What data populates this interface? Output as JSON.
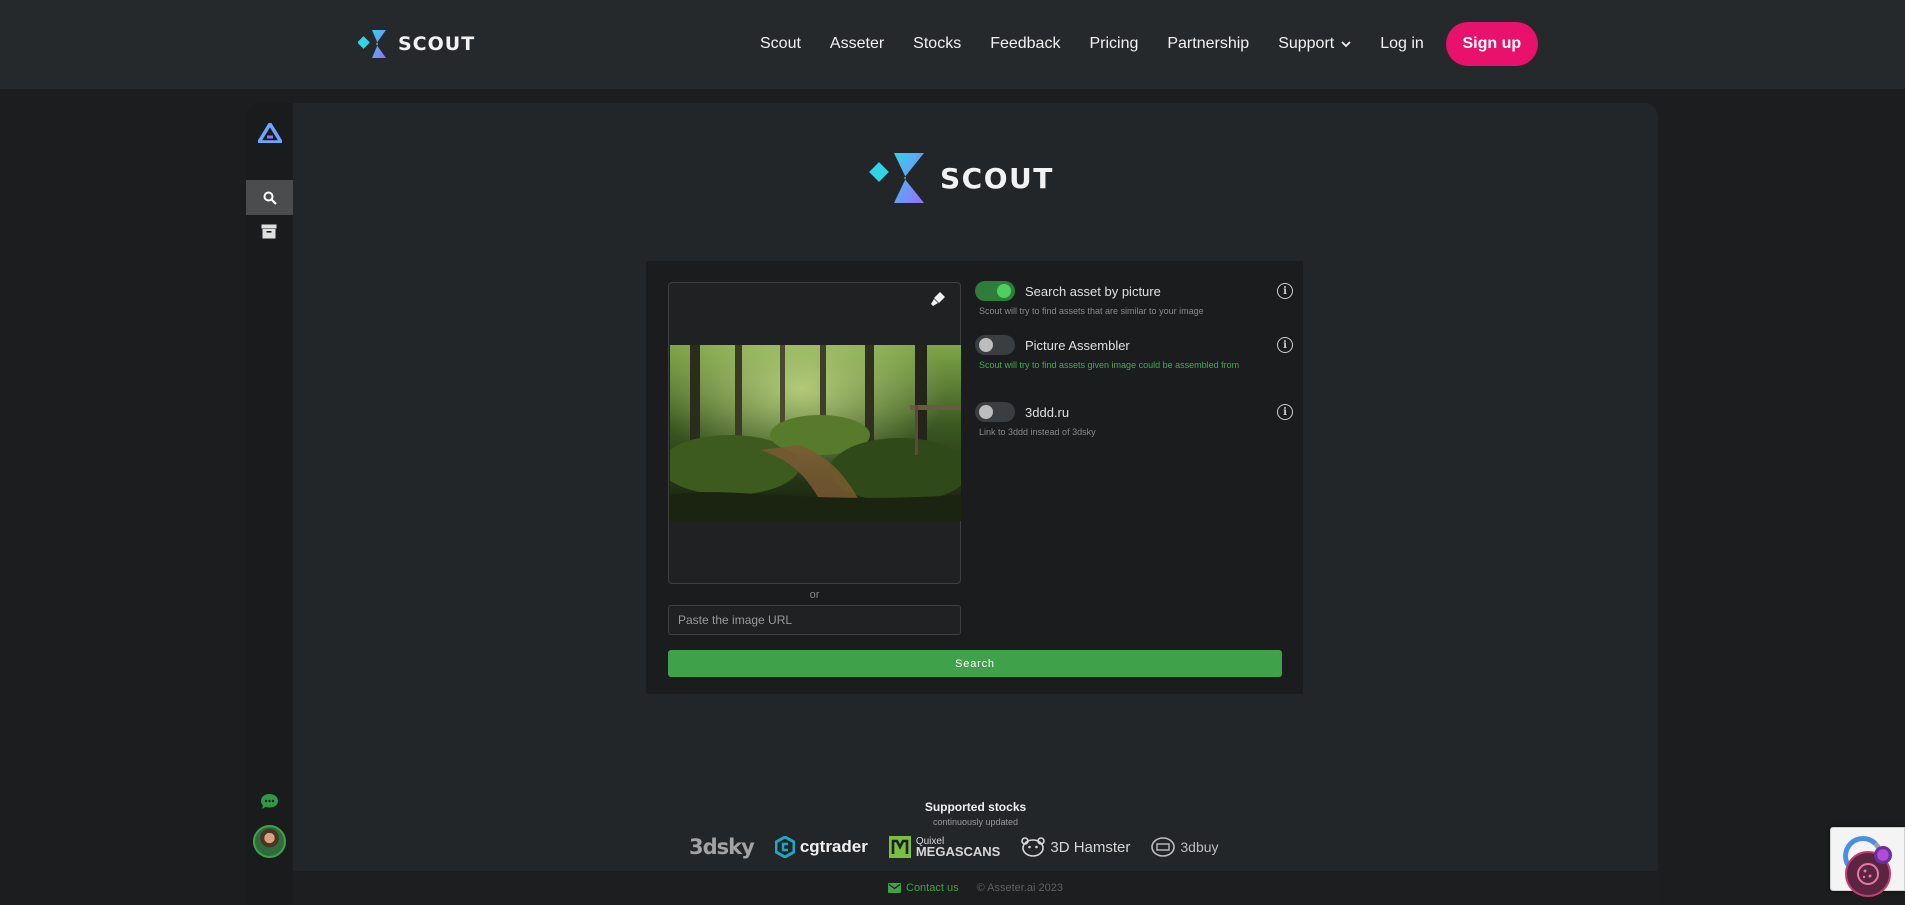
{
  "topnav": {
    "brand": "SCOUT",
    "links": [
      "Scout",
      "Asseter",
      "Stocks",
      "Feedback",
      "Pricing",
      "Partnership",
      "Support",
      "Log in"
    ],
    "signup": "Sign up"
  },
  "sidebar": {
    "items": [
      {
        "icon": "asseter-logo-icon"
      },
      {
        "icon": "search-icon",
        "active": true
      },
      {
        "icon": "archive-icon"
      },
      {
        "icon": "chat-icon"
      },
      {
        "icon": "avatar"
      }
    ]
  },
  "hero": {
    "brand": "SCOUT"
  },
  "search": {
    "or_text": "or",
    "url_placeholder": "Paste the image URL",
    "button": "Search",
    "options": [
      {
        "label": "Search asset by picture",
        "desc": "Scout will try to find assets that are similar to your image",
        "enabled": true
      },
      {
        "label": "Picture Assembler",
        "desc": "Scout will try to find assets given image could be assembled from",
        "enabled": false
      },
      {
        "label": "3ddd.ru",
        "desc": "Link to 3ddd instead of 3dsky",
        "enabled": false
      }
    ]
  },
  "supported": {
    "title": "Supported stocks",
    "subtitle": "continuously updated",
    "stocks": {
      "s1": "3dsky",
      "s2": "cgtrader",
      "s3_top": "Quixel",
      "s3_bottom": "MEGASCANS",
      "s4": "3D Hamster",
      "s5": "3dbuy"
    }
  },
  "footer": {
    "contact": "Contact us",
    "copyright": "© Asseter.ai 2023"
  },
  "colors": {
    "accent_pink": "#e8116b",
    "accent_green": "#3fa24b",
    "bg": "#1b1d1e",
    "nav_bg": "#25292c"
  }
}
